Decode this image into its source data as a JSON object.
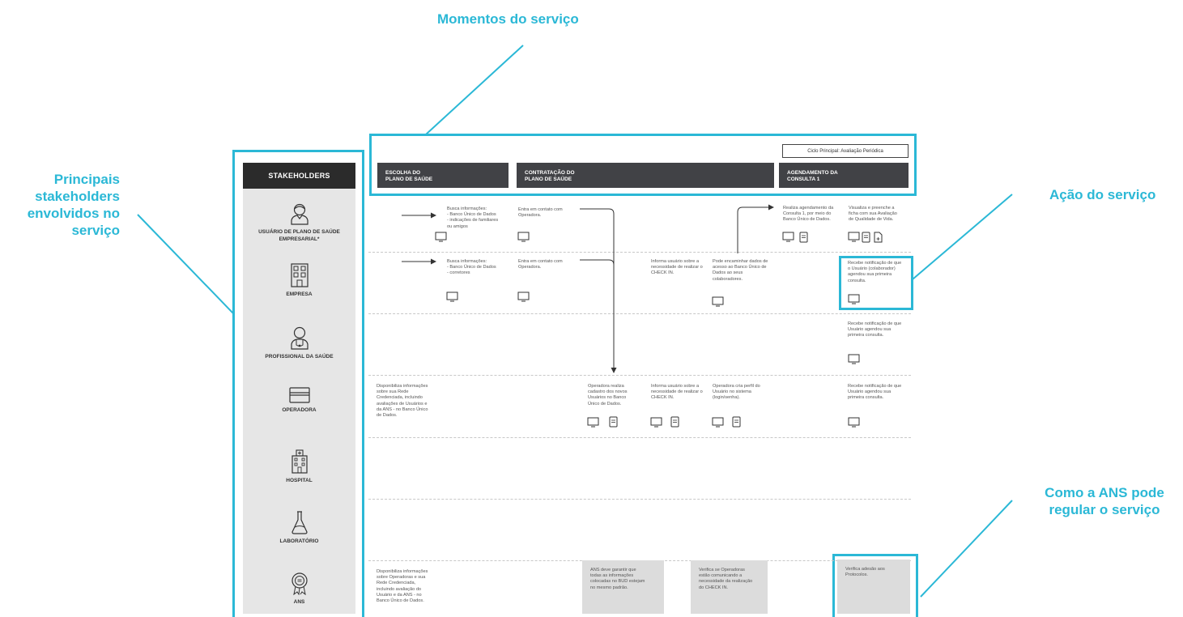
{
  "callouts": {
    "momentos": "Momentos do serviço",
    "stakeholders": "Principais\nstakeholders\nenvolvidos no\nserviço",
    "acao": "Ação do serviço",
    "ans": "Como a ANS pode\nregular o serviço"
  },
  "accent_color": "#2bb8d6",
  "stakeholders_header": "STAKEHOLDERS",
  "stakeholders": [
    {
      "label": "USUÁRIO DE PLANO DE SAÚDE EMPRESARIAL*",
      "icon": "user-icon"
    },
    {
      "label": "EMPRESA",
      "icon": "building-icon"
    },
    {
      "label": "PROFISSIONAL DA SAÚDE",
      "icon": "doctor-icon"
    },
    {
      "label": "OPERADORA",
      "icon": "card-icon"
    },
    {
      "label": "HOSPITAL",
      "icon": "hospital-icon"
    },
    {
      "label": "LABORATÓRIO",
      "icon": "flask-icon"
    },
    {
      "label": "ANS",
      "icon": "seal-icon"
    }
  ],
  "cycle_label": "Ciclo Principal: Avaliação Periódica",
  "phases": [
    {
      "title": "ESCOLHA DO\nPLANO DE SAÚDE"
    },
    {
      "title": "CONTRATAÇÃO DO\nPLANO DE SAÚDE"
    },
    {
      "title": "AGENDAMENTO DA\nCONSULTA 1"
    }
  ],
  "notes": {
    "u_busca": "Busca informações:\n- Banco Único de Dados\n- indicações de familiares\nou amigos",
    "u_entra": "Entra em contato com\nOperadora.",
    "u_realiza": "Realiza agendamento da\nConsulta 1, por meio do\nBanco Único de Dados.",
    "u_visualiza": "Visualiza e preenche a\nficha com sua Avaliação\nde Qualidade de Vida.",
    "e_busca": "Busca informações:\n- Banco Único de Dados\n- corretores",
    "e_entra": "Entra em contato com\nOperadora.",
    "e_informa": "Informa usuário sobre a\nnecessidade de realizar o\nCHECK IN.",
    "e_pode": "Pode encaminhar dados de\nacesso ao Banco Único de\nDados ao seus\ncolaboradores.",
    "e_recebe": "Recebe notificação de que\no Usuário (colaborador)\nagendou sua primeira\nconsulta.",
    "p_recebe": "Recebe notificação de que\nUsuário agendou sua\nprimeira consulta.",
    "o_disp": "Disponibiliza informações\nsobre sua Rede\nCredenciada, incluindo\navaliações de Usuários e\nda ANS - no Banco Único\nde Dados.",
    "o_realiza": "Operadora realiza\ncadastro dos novos\nUsuários no Banco\nÚnico de Dados.",
    "o_informa": "Informa usuário sobre a\nnecessidade de realizar o\nCHECK IN.",
    "o_cria": "Operadora cria perfil do\nUsuário no sistema\n(login/senha).",
    "o_recebe": "Recebe notificação de que\nUsuário agendou sua\nprimeira consulta.",
    "a_disp": "Disponibiliza informações\nsobre Operadoras e sua\nRede Credenciada,\nincluindo avaliação do\nUsuário e da ANS - no\nBanco Único de Dados.",
    "a_deve": "ANS deve garantir que\ntodas as informações\ncolocadas no BUD estejam\nno mesmo padrão.",
    "a_verifica": "Verifica se Operadoras\nestão comunicando a\nnecessidade da realização\ndo CHECK IN.",
    "a_adesao": "Verifica adesão aos\nProtocolos."
  }
}
